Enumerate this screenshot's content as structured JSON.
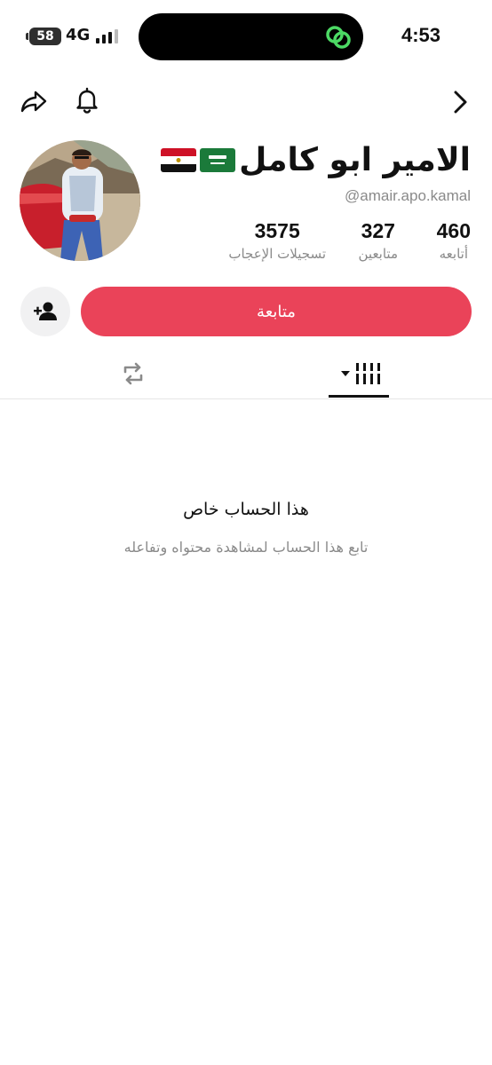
{
  "status_bar": {
    "battery": "58",
    "network": "4G",
    "time": "4:53"
  },
  "profile": {
    "display_name": "الامير ابو كامل",
    "handle": "@amair.apo.kamal",
    "flags": [
      "saudi-arabia-flag",
      "egypt-flag"
    ],
    "stats": {
      "following": {
        "value": "460",
        "label": "أتابعه"
      },
      "followers": {
        "value": "327",
        "label": "متابعين"
      },
      "likes": {
        "value": "3575",
        "label": "تسجيلات الإعجاب"
      }
    }
  },
  "actions": {
    "follow_label": "متابعة"
  },
  "private_notice": {
    "title": "هذا الحساب خاص",
    "subtitle": "تابع هذا الحساب لمشاهدة محتواه وتفاعله"
  },
  "icons": {
    "share": "share-icon",
    "bell": "bell-icon",
    "back": "chevron-right-icon",
    "add_friend": "add-friend-icon",
    "reposts": "repost-icon",
    "videos": "videos-grid-icon"
  },
  "colors": {
    "follow_button": "#ea4359",
    "secondary_text": "#8a8a8a",
    "island_accent": "#4cd964"
  }
}
